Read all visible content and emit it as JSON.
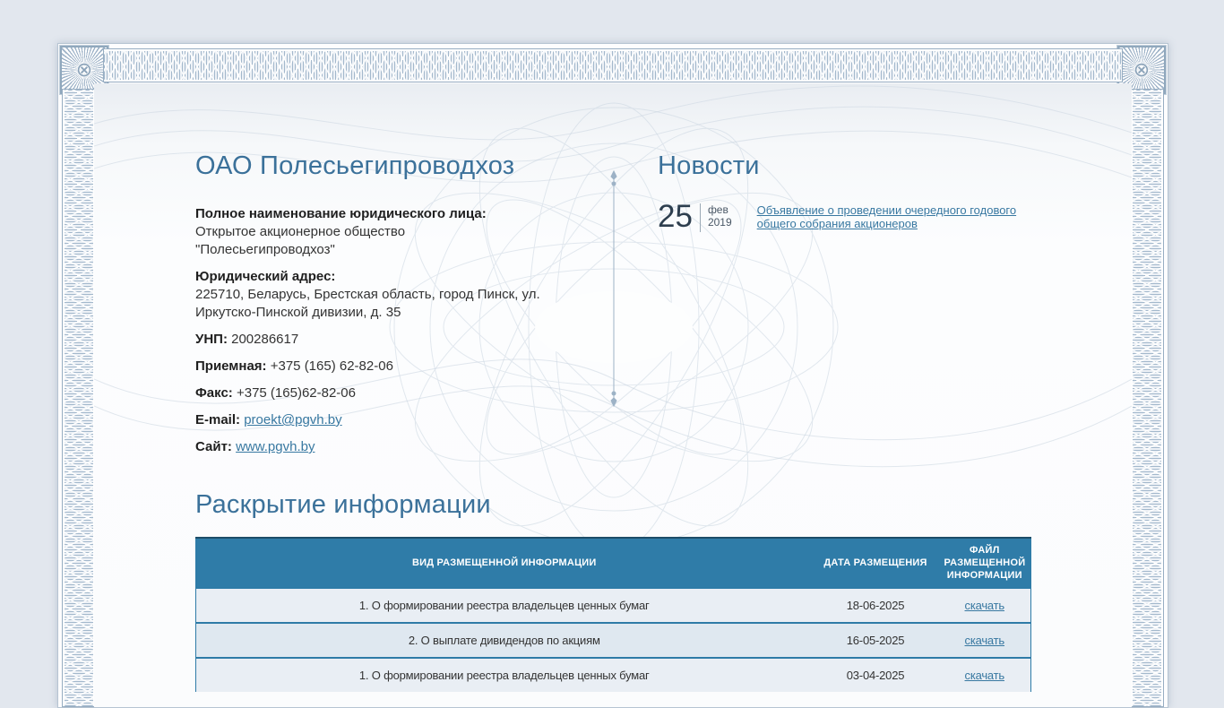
{
  "company": {
    "title": "ОАО Полесьегипроводхоз",
    "fields": [
      {
        "label": "Полное наименование юридического лица:",
        "value": "Открытое акционерное общество \"Полесьегипроводхоз\""
      },
      {
        "label": "Юридический адрес:",
        "value": "225710, Беларусь, Брестская область, город Пинск, ул. Иркутско-Пинской дивизии, д. 35"
      },
      {
        "label": "УНП:",
        "value": "200286617"
      },
      {
        "label": "Приемная:",
        "value": "+375 (165) 62-82-06"
      },
      {
        "label": "Факс:",
        "value": "+375 (165)62-82-06"
      },
      {
        "label": "E-mail:",
        "value": "proekt@pgvh.by"
      },
      {
        "label": "Сайт:",
        "value": "www.pgvh.by"
      }
    ]
  },
  "news": {
    "title": "Новости",
    "item": {
      "day": "25",
      "month": "фев",
      "year": "2019",
      "link": "Объявление о проведении очередного годового общего собрания акционеров"
    }
  },
  "disclosure": {
    "title": "Раскрытие информации",
    "table": {
      "columns": [
        "ВИД РАЗМЕЩЕННОЙ ИНФОРМАЦИИ",
        "ДАТА РАЗМЕЩЕНИЯ",
        "ФАЙЛ РАЗМЕЩЕННОЙ ИНФОРМАЦИИ"
      ],
      "rows": [
        {
          "kind": "1. О формировании реестра владельцев ценных бумаг",
          "date": "18-06-2025",
          "download_label": "скачать"
        },
        {
          "kind": "2. О выплате дивидендов по акциям",
          "date": "16-05-2025",
          "download_label": "скачать"
        },
        {
          "kind": "1. О формировании реестра владельцев ценных бумаг",
          "date": "03-04-2025",
          "download_label": "скачать"
        }
      ]
    }
  },
  "colors": {
    "accent_heading": "#3b719a",
    "table_header_bg": "#2f7ca8",
    "link": "#3878a1",
    "page_bg": "#e2e7ee"
  }
}
